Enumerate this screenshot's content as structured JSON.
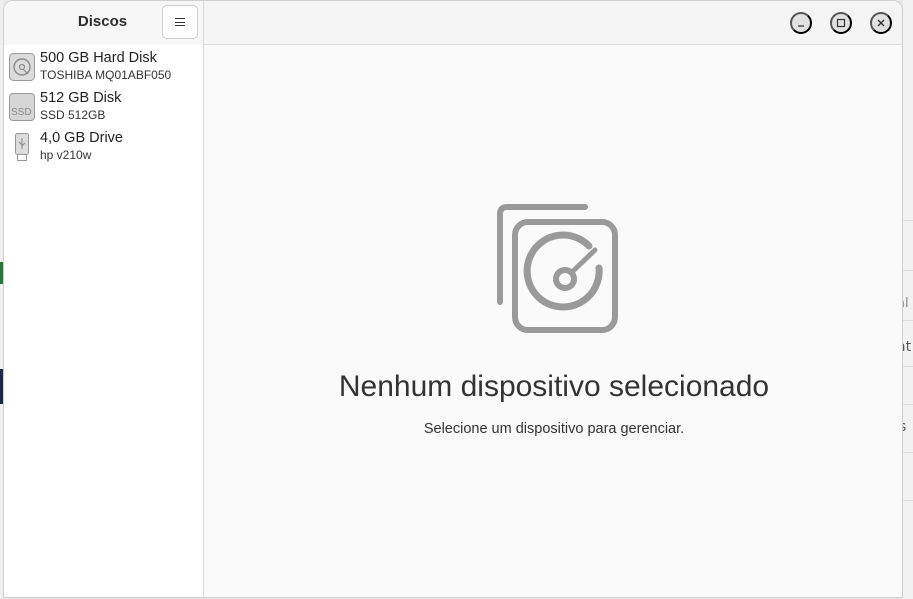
{
  "sidebar": {
    "title": "Discos",
    "menu_icon": "hamburger-icon",
    "disks": [
      {
        "name": "500 GB Hard Disk",
        "model": "TOSHIBA MQ01ABF050",
        "icon": "hard-disk-icon"
      },
      {
        "name": "512 GB Disk",
        "model": "SSD 512GB",
        "icon": "ssd-icon",
        "icon_label": "SSD"
      },
      {
        "name": "4,0 GB Drive",
        "model": "hp v210w",
        "icon": "usb-drive-icon"
      }
    ]
  },
  "window_controls": {
    "minimize_icon": "minimize-icon",
    "maximize_icon": "maximize-icon",
    "close_icon": "close-icon"
  },
  "main": {
    "empty_icon": "disks-icon",
    "empty_title": "Nenhum dispositivo selecionado",
    "empty_subtitle": "Selecione um dispositivo para gerenciar."
  },
  "background": {
    "fragments": [
      "al",
      "at",
      "s"
    ]
  },
  "colors": {
    "icon_gray": "#9a9a9a",
    "text": "#333333"
  }
}
